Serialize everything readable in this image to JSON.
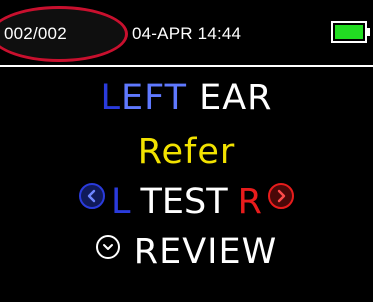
{
  "status_bar": {
    "record_counter": "002/002",
    "datetime": "04-APR 14:44",
    "battery_level": 1.0,
    "battery_color": "#22dd22",
    "highlight_color": "#c8102e"
  },
  "screen": {
    "ear_side": "LEFT",
    "ear_word": "EAR",
    "result": "Refer",
    "test_left": "L",
    "test_label": "TEST",
    "test_right": "R",
    "review_label": "REVIEW"
  },
  "colors": {
    "left_blue": "#2a3bdc",
    "right_red": "#e81c1c",
    "refer_yellow": "#f2e200",
    "background": "#000000"
  },
  "icons": {
    "prev": "chevron-left-icon",
    "next": "chevron-right-icon",
    "review": "chevron-down-icon"
  }
}
